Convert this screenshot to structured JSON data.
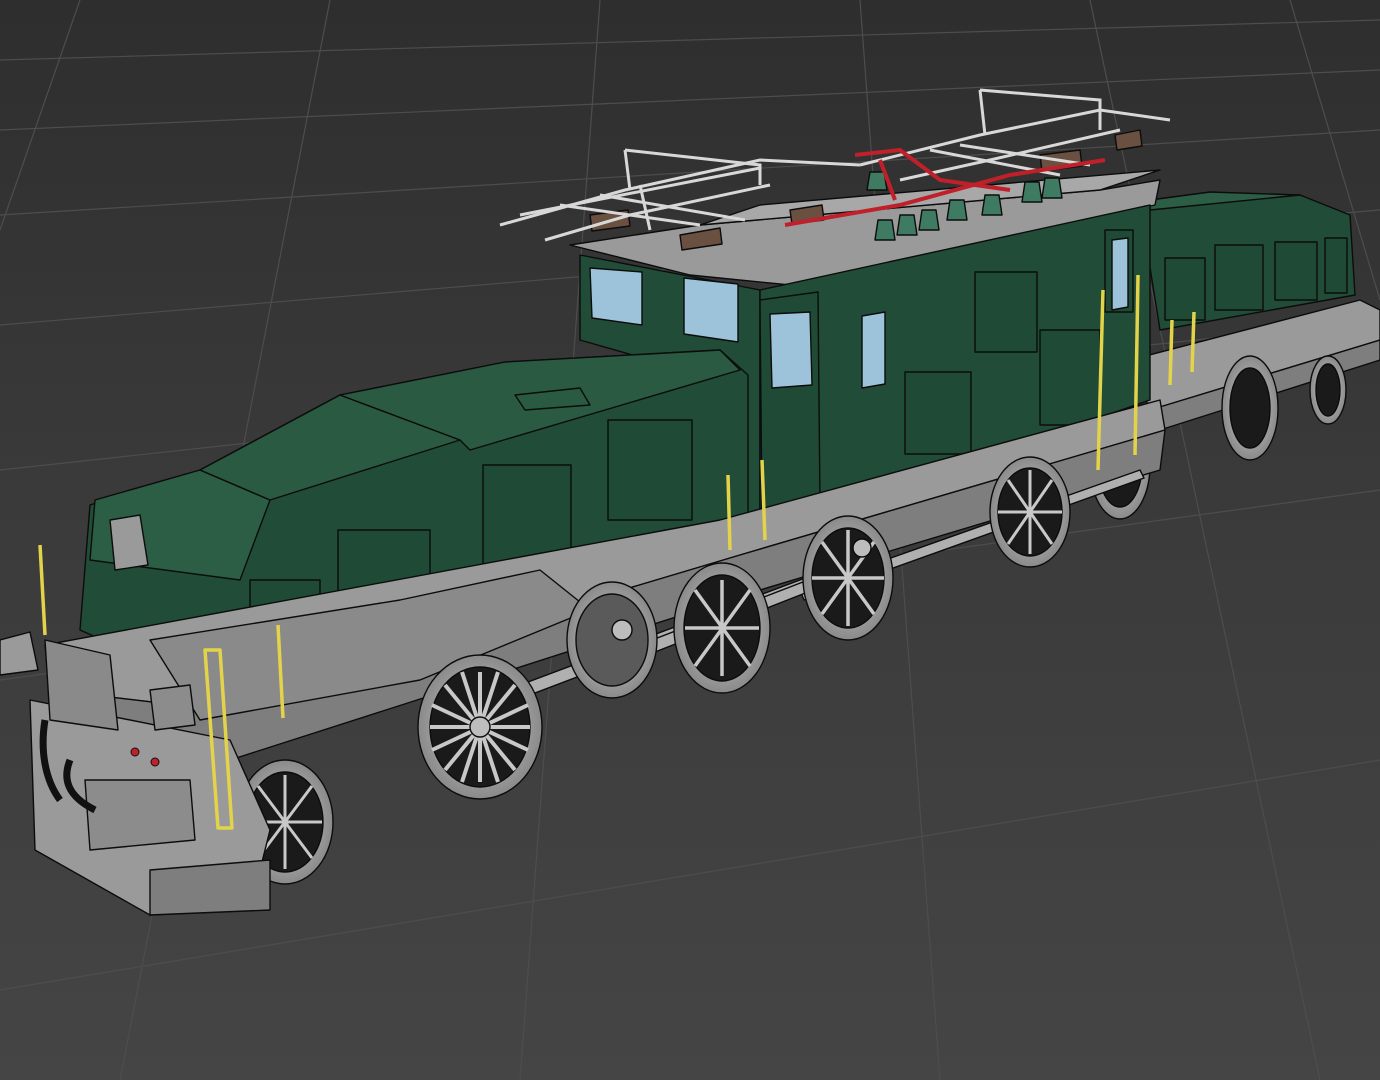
{
  "viewport": {
    "background_color": "#3a3a3a",
    "grid_color": "#4a4a4a",
    "object": "3d-model-electric-locomotive-wireframe-shaded"
  },
  "colors": {
    "body_green": "#214d38",
    "body_green_light": "#2c5e45",
    "edge_dark": "#0c0c0c",
    "frame_gray": "#9a9a9a",
    "frame_gray_dark": "#7e7e7e",
    "window_blue": "#9cc3da",
    "handrail_yellow": "#e3d34a",
    "pantograph_red": "#c0202a",
    "insulator_green": "#3f7a62",
    "insulator_brown": "#6a5040"
  }
}
